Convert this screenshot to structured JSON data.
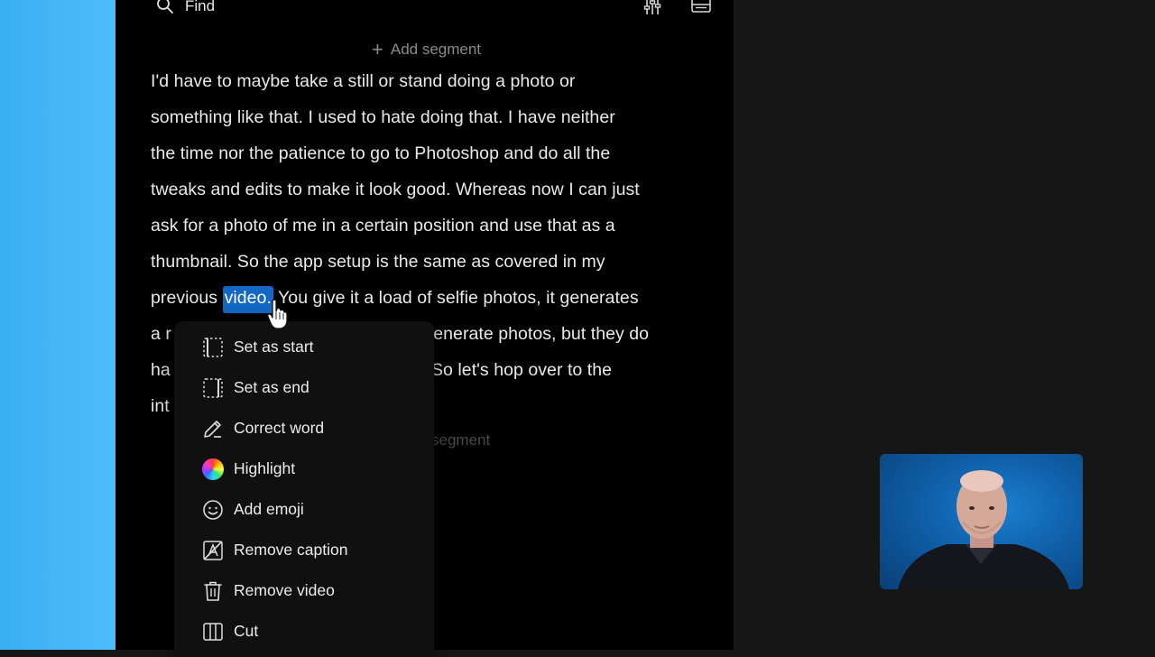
{
  "find": {
    "label": "Find"
  },
  "add_segment_top": "Add segment",
  "add_segment_bottom_partial": "segment",
  "transcript": {
    "lines": [
      "I'd have to maybe take a still or stand doing a photo or",
      "something like that. I used to hate doing that. I have neither",
      "the time nor the patience to go to Photoshop and do all the",
      "tweaks and edits to make it look good. Whereas now I can just",
      "ask for a photo of me in a certain position and use that as a",
      "thumbnail. So the app setup is the same as covered in my"
    ],
    "line7_before": "previous ",
    "selected_word": "video.",
    "line7_after": " You give it a load of selfie photos, it generates",
    "line8_left": "a r",
    "line8_right": "o generate photos, but they do",
    "line9_left": "ha",
    "line9_right": "So let's hop over to the",
    "line10_left": "int"
  },
  "context_menu": {
    "items": [
      {
        "label": "Set as start",
        "icon": "set-start-icon"
      },
      {
        "label": "Set as end",
        "icon": "set-end-icon"
      },
      {
        "label": "Correct word",
        "icon": "pencil-icon"
      },
      {
        "label": "Highlight",
        "icon": "color-wheel-icon"
      },
      {
        "label": "Add emoji",
        "icon": "smiley-icon"
      },
      {
        "label": "Remove caption",
        "icon": "remove-caption-icon"
      },
      {
        "label": "Remove video",
        "icon": "trash-icon"
      },
      {
        "label": "Cut",
        "icon": "cut-icon"
      }
    ]
  },
  "colors": {
    "accent_selection": "#1268c4",
    "side_strip": "#46b8f8",
    "editor_bg": "#000000"
  }
}
